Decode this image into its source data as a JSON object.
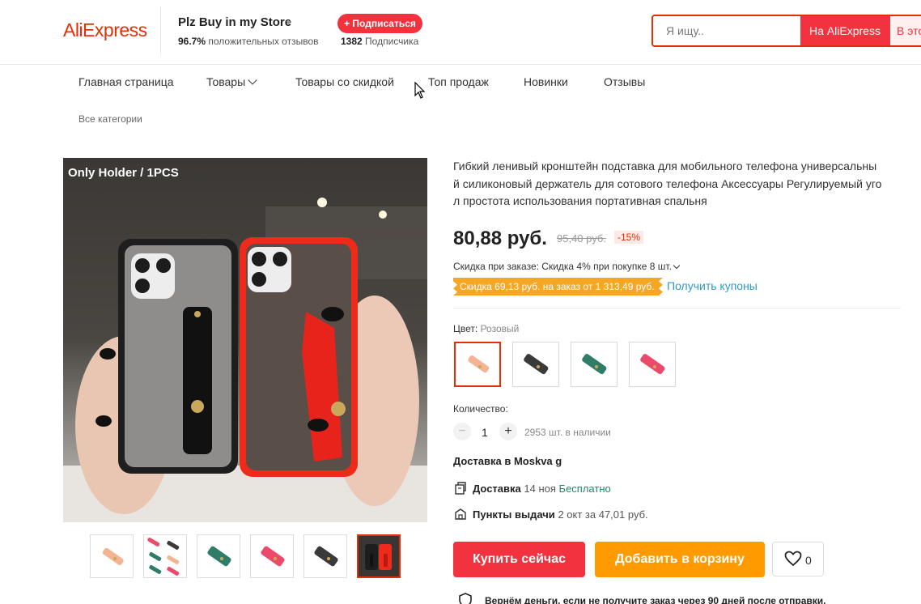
{
  "header": {
    "logo": "AliExpress",
    "store_name": "Plz Buy in my Store",
    "rating_value": "96.7%",
    "rating_text": "положительных отзывов",
    "subscribe_label": "+ Подписаться",
    "subscribers_count": "1382",
    "subscribers_text": "Подписчика",
    "search_placeholder": "Я ищу..",
    "search_btn_aliexpress": "На AliExpress",
    "search_btn_store": "В это"
  },
  "nav": {
    "items": [
      "Главная страница",
      "Товары",
      "Товары со скидкой",
      "Топ продаж",
      "Новинки",
      "Отзывы"
    ],
    "all_categories": "Все категории"
  },
  "gallery": {
    "caption": "Only Holder / 1PCS",
    "thumbnails": [
      "pink-holder",
      "multi-color-holders",
      "green-holder",
      "rose-holder",
      "black-holder",
      "phones-photo"
    ],
    "active_thumbnail": 5
  },
  "product": {
    "title": "Гибкий ленивый кронштейн подставка для мобильного телефона универсальный силиконовый держатель для сотового телефона Аксессуары Регулируемый угол простота использования портативная спальня",
    "title_lines": [
      "Гибкий ленивый кронштейн подставка для мобильного телефона универсальны",
      "й силиконовый держатель для сотового телефона Аксессуары Регулируемый уго",
      "л простота использования портативная спальня"
    ],
    "price": "80,88 руб.",
    "old_price": "95,40 руб.",
    "discount": "-15%",
    "order_discount": "Скидка при заказе: Скидка 4% при покупке 8 шт.",
    "coupon_band": "Скидка 69,13 руб. на заказ от 1 313,49 руб.",
    "get_coupons": "Получить купоны",
    "color_label": "Цвет:",
    "color_value": "Розовый",
    "colors": [
      {
        "name": "pink",
        "hex": "#f4b393"
      },
      {
        "name": "black",
        "hex": "#3a3a3a"
      },
      {
        "name": "green",
        "hex": "#2f7d68"
      },
      {
        "name": "rose",
        "hex": "#ec4a6b"
      }
    ],
    "selected_color": 0,
    "quantity_label": "Количество:",
    "quantity": "1",
    "stock": "2953 шт. в наличии",
    "delivery_heading": "Доставка в Moskva g",
    "delivery": {
      "label": "Доставка",
      "date": "14 ноя",
      "price": "Бесплатно"
    },
    "pickup": {
      "label": "Пункты выдачи",
      "date": "2 окт",
      "price": "за 47,01 руб."
    },
    "buy_now": "Купить сейчас",
    "add_to_cart": "Добавить в корзину",
    "wishlist_count": "0",
    "guarantee": "Вернём деньги, если не получите заказ через 90 дней после отправки."
  },
  "colors": {
    "accent": "#e62e04",
    "buy": "#f2323f",
    "cart": "#ff9a00",
    "coupon": "#f5a623",
    "link": "#2e9cc8",
    "free": "#1e8a63"
  }
}
